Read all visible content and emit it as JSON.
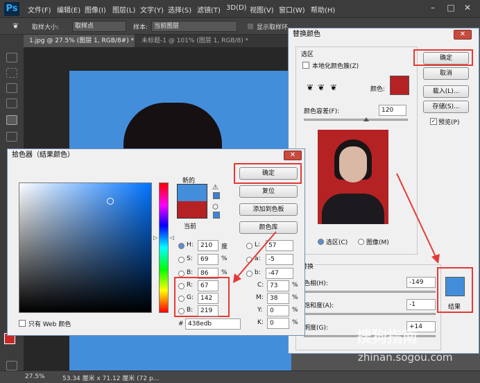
{
  "menubar": {
    "logo": "Ps",
    "items": [
      "文件(F)",
      "编辑(E)",
      "图像(I)",
      "图层(L)",
      "文字(Y)",
      "选择(S)",
      "滤镜(T)",
      "3D(D)",
      "视图(V)",
      "窗口(W)",
      "帮助(H)"
    ]
  },
  "options": {
    "sample_size_label": "取样大小:",
    "sample_size_value": "取样点",
    "sample_label": "样本:",
    "sample_value": "当前图层",
    "show_ring": "显示取样环"
  },
  "tabs": [
    "1.jpg @ 27.5% (图层 1, RGB/8#) *",
    "未标题-1 @ 101% (图层 1, RGB/8) *"
  ],
  "status": {
    "zoom": "27.5%",
    "doc_info": "53.34 厘米 x 71.12 厘米 (72 p..."
  },
  "replace_color": {
    "title": "替换颜色",
    "selection_section": "选区",
    "localized_clusters": "本地化颜色簇(Z)",
    "color_label": "颜色:",
    "selected_color": "#b52223",
    "fuzziness_label": "颜色容差(F):",
    "fuzziness_value": "120",
    "ok": "确定",
    "cancel": "取消",
    "load": "载入(L)...",
    "save": "存储(S)...",
    "preview": "预览(P)",
    "view_selection": "选区(C)",
    "view_image": "图像(M)",
    "replace_section": "替换",
    "hue_label": "色相(H):",
    "hue_value": "-149",
    "saturation_label": "饱和度(A):",
    "saturation_value": "-1",
    "lightness_label": "明度(G):",
    "lightness_value": "+14",
    "result_label": "结果",
    "result_color": "#438edb"
  },
  "picker": {
    "title": "拾色器（结果颜色）",
    "new_label": "新的",
    "current_label": "当前",
    "new_color": "#438edb",
    "current_color": "#b52223",
    "ok": "确定",
    "reset": "复位",
    "add_swatch": "添加到色板",
    "color_libraries": "颜色库",
    "web_only": "只有 Web 颜色",
    "H": {
      "label": "H:",
      "value": "210",
      "unit": "度"
    },
    "S": {
      "label": "S:",
      "value": "69",
      "unit": "%"
    },
    "B": {
      "label": "B:",
      "value": "86",
      "unit": "%"
    },
    "R": {
      "label": "R:",
      "value": "67"
    },
    "G": {
      "label": "G:",
      "value": "142"
    },
    "Bl": {
      "label": "B:",
      "value": "219"
    },
    "L": {
      "label": "L:",
      "value": "57"
    },
    "a": {
      "label": "a:",
      "value": "-5"
    },
    "b": {
      "label": "b:",
      "value": "-47"
    },
    "C": {
      "label": "C:",
      "value": "73",
      "unit": "%"
    },
    "M": {
      "label": "M:",
      "value": "38",
      "unit": "%"
    },
    "Y": {
      "label": "Y:",
      "value": "0",
      "unit": "%"
    },
    "K": {
      "label": "K:",
      "value": "0",
      "unit": "%"
    },
    "hex_label": "#",
    "hex_value": "438edb"
  },
  "watermark": {
    "text": "搜狗指南",
    "url": "zhinan.sogou.com"
  }
}
